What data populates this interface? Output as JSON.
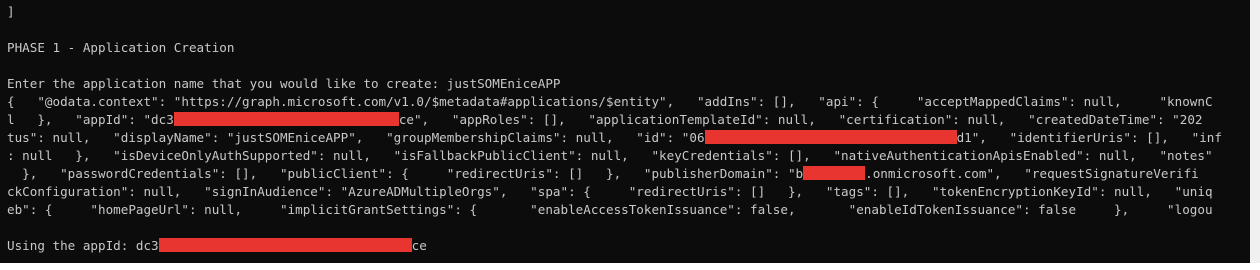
{
  "console": {
    "line_bracket": "]",
    "phase_title": "PHASE 1 - Application Creation",
    "prompt": "Enter the application name that you would like to create: justSOMEniceAPP",
    "json_1": "{   \"@odata.context\": \"https://graph.microsoft.com/v1.0/$metadata#applications/$entity\",   \"addIns\": [],   \"api\": {     \"acceptMappedClaims\": null,     \"knownC",
    "json_2a": "l   },   \"appId\": \"dc3",
    "json_2b": "ce\",   \"appRoles\": [],   \"applicationTemplateId\": null,   \"certification\": null,   \"createdDateTime\": \"202",
    "json_3a": "tus\": null,   \"displayName\": \"justSOMEniceAPP\",   \"groupMembershipClaims\": null,   \"id\": \"06",
    "json_3b": "d1\",   \"identifierUris\": [],   \"inf",
    "json_4": ": null   },   \"isDeviceOnlyAuthSupported\": null,   \"isFallbackPublicClient\": null,   \"keyCredentials\": [],   \"nativeAuthenticationApisEnabled\": null,   \"notes\"",
    "json_5a": "  },   \"passwordCredentials\": [],   \"publicClient\": {     \"redirectUris\": []   },   \"publisherDomain\": \"b",
    "json_5b": ".onmicrosoft.com\",   \"requestSignatureVerifi",
    "json_6": "ckConfiguration\": null,   \"signInAudience\": \"AzureADMultipleOrgs\",   \"spa\": {     \"redirectUris\": []   },   \"tags\": [],   \"tokenEncryptionKeyId\": null,   \"uniq",
    "json_7": "eb\": {     \"homePageUrl\": null,     \"implicitGrantSettings\": {       \"enableAccessTokenIssuance\": false,       \"enableIdTokenIssuance\": false     },     \"logou",
    "using_a": "Using the appId: dc3",
    "using_b": "ce"
  },
  "colors": {
    "background": "#0c0c0c",
    "text": "#c8c8c8",
    "redaction": "#e8352f"
  }
}
